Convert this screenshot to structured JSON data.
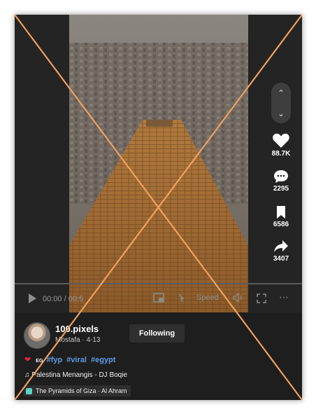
{
  "actions": [
    {
      "icon": "heart-icon",
      "count": "88.7K"
    },
    {
      "icon": "comment-icon",
      "count": "2295"
    },
    {
      "icon": "bookmark-icon",
      "count": "6586"
    },
    {
      "icon": "share-icon",
      "count": "3407"
    }
  ],
  "player": {
    "time": "00:00 / 00:5",
    "speed_label": "Speed"
  },
  "author": {
    "username": "100.pixels",
    "subline": "Mostafa · 4-13",
    "follow_label": "Following"
  },
  "caption": {
    "prefix": "EG",
    "hashtags": [
      "#fyp",
      "#viral",
      "#egypt"
    ]
  },
  "music": "Palestina Menangis - DJ Boqie",
  "location": "The Pyramids of Giza · Al Ahram",
  "colors": {
    "accent": "#e8243f",
    "hashtag": "#5f9be8",
    "overlay_cross": "#f0a060"
  }
}
